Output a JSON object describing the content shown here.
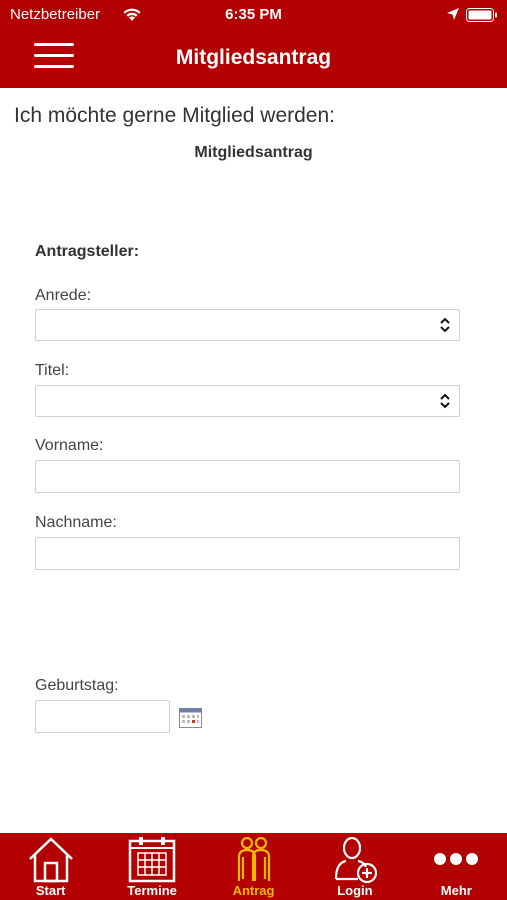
{
  "status_bar": {
    "carrier": "Netzbetreiber",
    "time": "6:35 PM"
  },
  "nav": {
    "title": "Mitgliedsantrag"
  },
  "intro": "Ich möchte gerne Mitglied werden:",
  "form_title": "Mitgliedsantrag",
  "section": "Antragsteller:",
  "fields": {
    "anrede": {
      "label": "Anrede:",
      "value": ""
    },
    "titel": {
      "label": "Titel:",
      "value": ""
    },
    "vorname": {
      "label": "Vorname:",
      "value": ""
    },
    "nachname": {
      "label": "Nachname:",
      "value": ""
    },
    "geburtstag": {
      "label": "Geburtstag:",
      "value": ""
    }
  },
  "tabs": [
    {
      "label": "Start",
      "icon": "house-icon",
      "active": false
    },
    {
      "label": "Termine",
      "icon": "calendar-icon",
      "active": false
    },
    {
      "label": "Antrag",
      "icon": "people-icon",
      "active": true
    },
    {
      "label": "Login",
      "icon": "user-add-icon",
      "active": false
    },
    {
      "label": "Mehr",
      "icon": "more-dots-icon",
      "active": false
    }
  ],
  "colors": {
    "brand": "#b30000",
    "active_tab": "#f5b800"
  }
}
